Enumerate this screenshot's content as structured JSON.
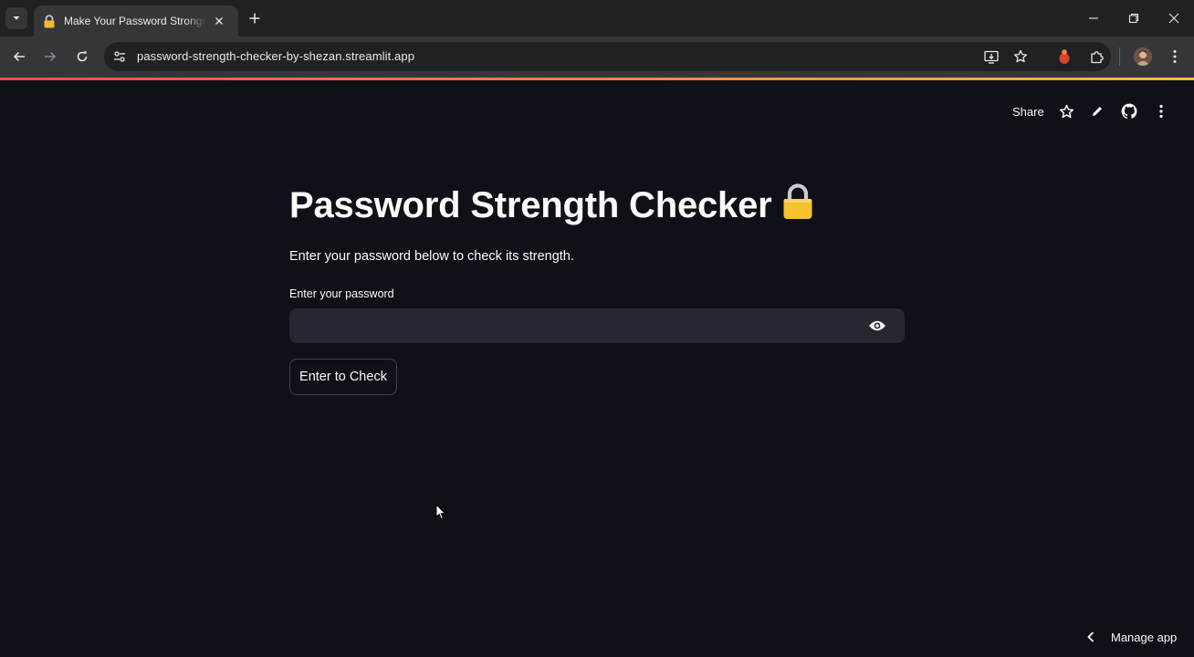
{
  "browser": {
    "tab_title": "Make Your Password Stronger",
    "url": "password-strength-checker-by-shezan.streamlit.app"
  },
  "app_header": {
    "share_label": "Share"
  },
  "main": {
    "title": "Password Strength Checker",
    "title_emoji": "lock-icon",
    "subtitle": "Enter your password below to check its strength.",
    "password_label": "Enter your password",
    "password_value": "",
    "password_placeholder": "",
    "check_button_label": "Enter to Check"
  },
  "footer": {
    "manage_app_label": "Manage app"
  },
  "colors": {
    "background": "#0e1117",
    "input_background": "#262730",
    "accent_start": "#ff4b4b",
    "accent_end": "#ffbd45",
    "lock_yellow": "#f5c230"
  }
}
